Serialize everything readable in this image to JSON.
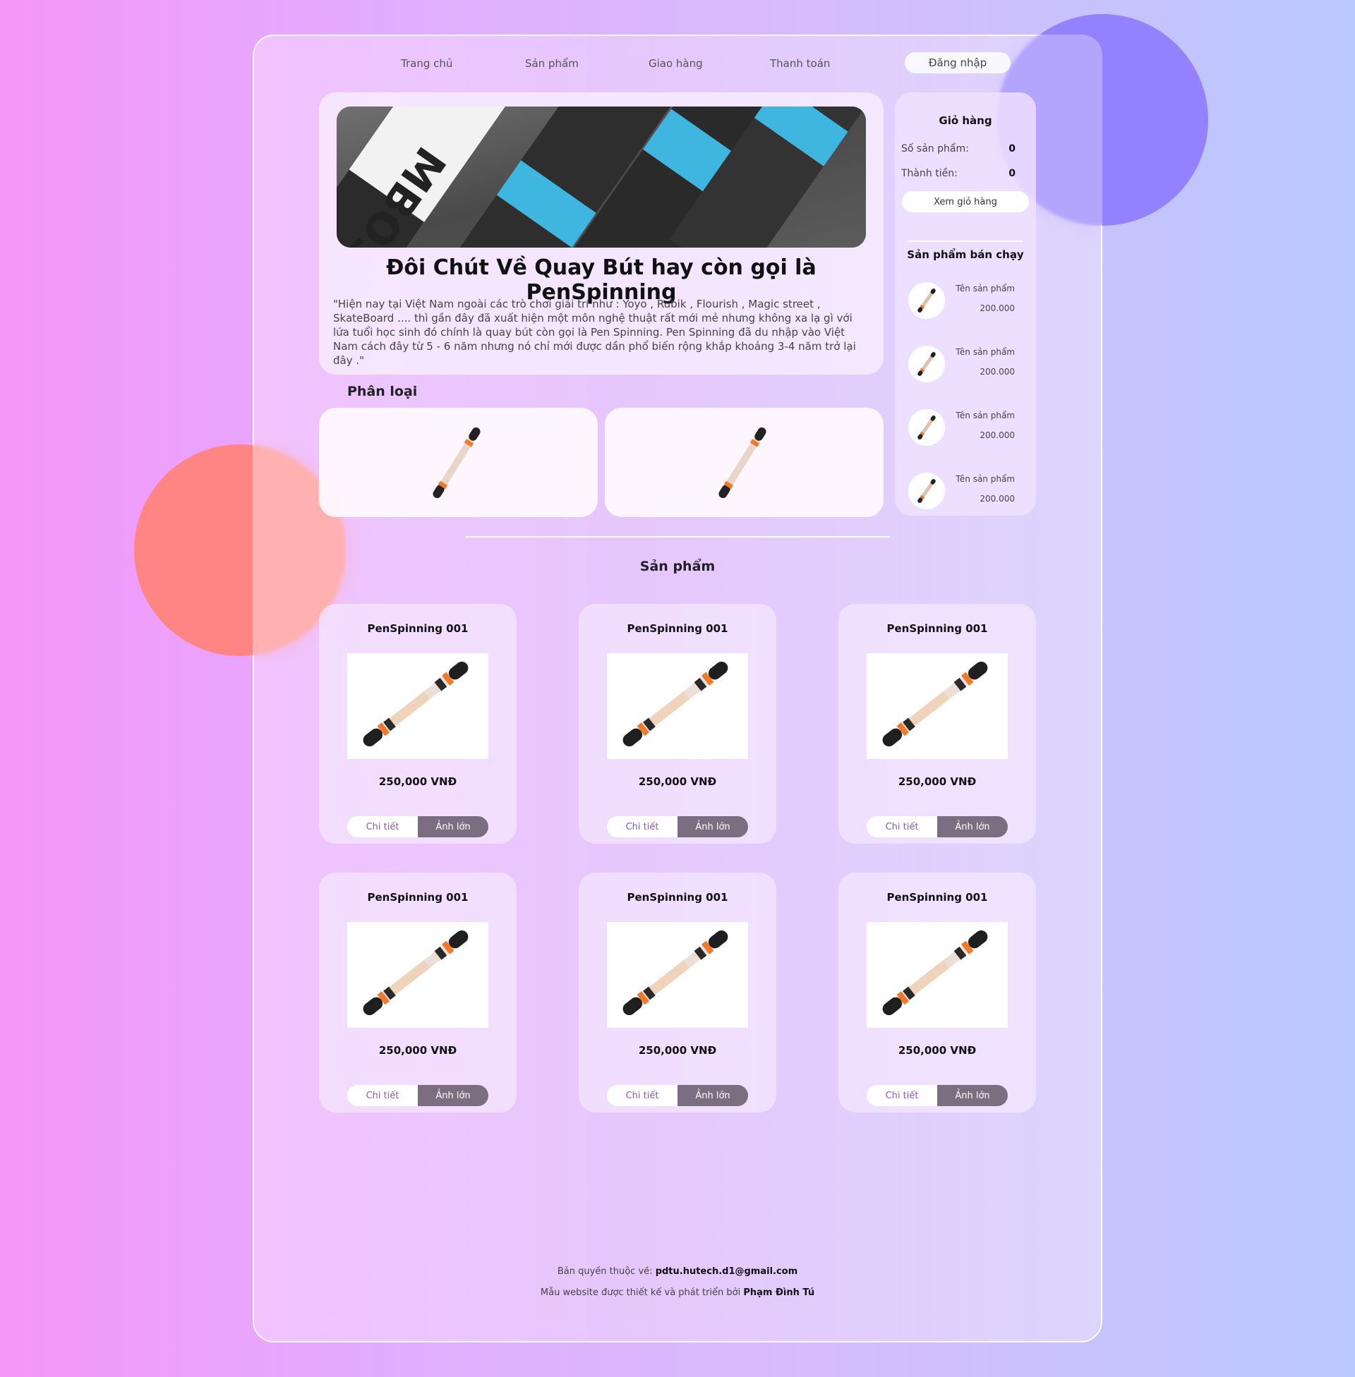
{
  "nav": {
    "links": [
      "Trang chủ",
      "Sản phẩm",
      "Giao hàng",
      "Thanh toán"
    ],
    "login": "Đăng nhập"
  },
  "hero": {
    "title": "Đôi Chút Về Quay Bút hay còn gọi là PenSpinning",
    "text": "\"Hiện nay tại Việt Nam ngoài các trò chơi giải trí như : Yoyo , Rubik , Flourish , Magic street , SkateBoard .... thì gần đây đã xuất hiện một môn nghệ thuật rất mới mẻ nhưng không xa lạ gì với lứa tuổi học sinh đó chính là quay bút còn gọi là Pen Spinning. Pen Spinning đã du nhập vào Việt Nam cách đây từ 5 - 6 năm nhưng nó chỉ mới được dần phổ biến rộng khắp khoảng 3-4 năm trở lại đây .\"",
    "image_text": "MBOSS"
  },
  "categories": {
    "title": "Phân loại"
  },
  "cart": {
    "title": "Giỏ hàng",
    "count_label": "Số sản phẩm:",
    "count_value": "0",
    "total_label": "Thành tiền:",
    "total_value": "0",
    "view_button": "Xem giỏ hàng"
  },
  "bestsellers": {
    "title": "Sản phẩm bán chạy",
    "items": [
      {
        "name": "Tên sản phẩm",
        "price": "200.000"
      },
      {
        "name": "Tên sản phẩm",
        "price": "200.000"
      },
      {
        "name": "Tên sản phẩm",
        "price": "200.000"
      },
      {
        "name": "Tên sản phẩm",
        "price": "200.000"
      }
    ]
  },
  "products": {
    "title": "Sản phẩm",
    "items": [
      {
        "name": "PenSpinning 001",
        "price": "250,000 VNĐ",
        "detail": "Chi tiết",
        "big": "Ảnh lớn"
      },
      {
        "name": "PenSpinning 001",
        "price": "250,000 VNĐ",
        "detail": "Chi tiết",
        "big": "Ảnh lớn"
      },
      {
        "name": "PenSpinning 001",
        "price": "250,000 VNĐ",
        "detail": "Chi tiết",
        "big": "Ảnh lớn"
      },
      {
        "name": "PenSpinning 001",
        "price": "250,000 VNĐ",
        "detail": "Chi tiết",
        "big": "Ảnh lớn"
      },
      {
        "name": "PenSpinning 001",
        "price": "250,000 VNĐ",
        "detail": "Chi tiết",
        "big": "Ảnh lớn"
      },
      {
        "name": "PenSpinning 001",
        "price": "250,000 VNĐ",
        "detail": "Chi tiết",
        "big": "Ảnh lớn"
      }
    ]
  },
  "footer": {
    "copyright_label": "Bản quyền thuộc về:",
    "copyright_email": "pdtu.hutech.d1@gmail.com",
    "design_label": "Mẫu website được thiết kế và phát triển bởi",
    "design_author": "Phạm Đình Tú"
  },
  "colors": {
    "blob_purple": "#9481fe",
    "blob_red": "#ff8585",
    "button_dark": "#7a6e80",
    "pen_orange": "#f07a2a",
    "roller_blue": "#3fb6e0"
  }
}
